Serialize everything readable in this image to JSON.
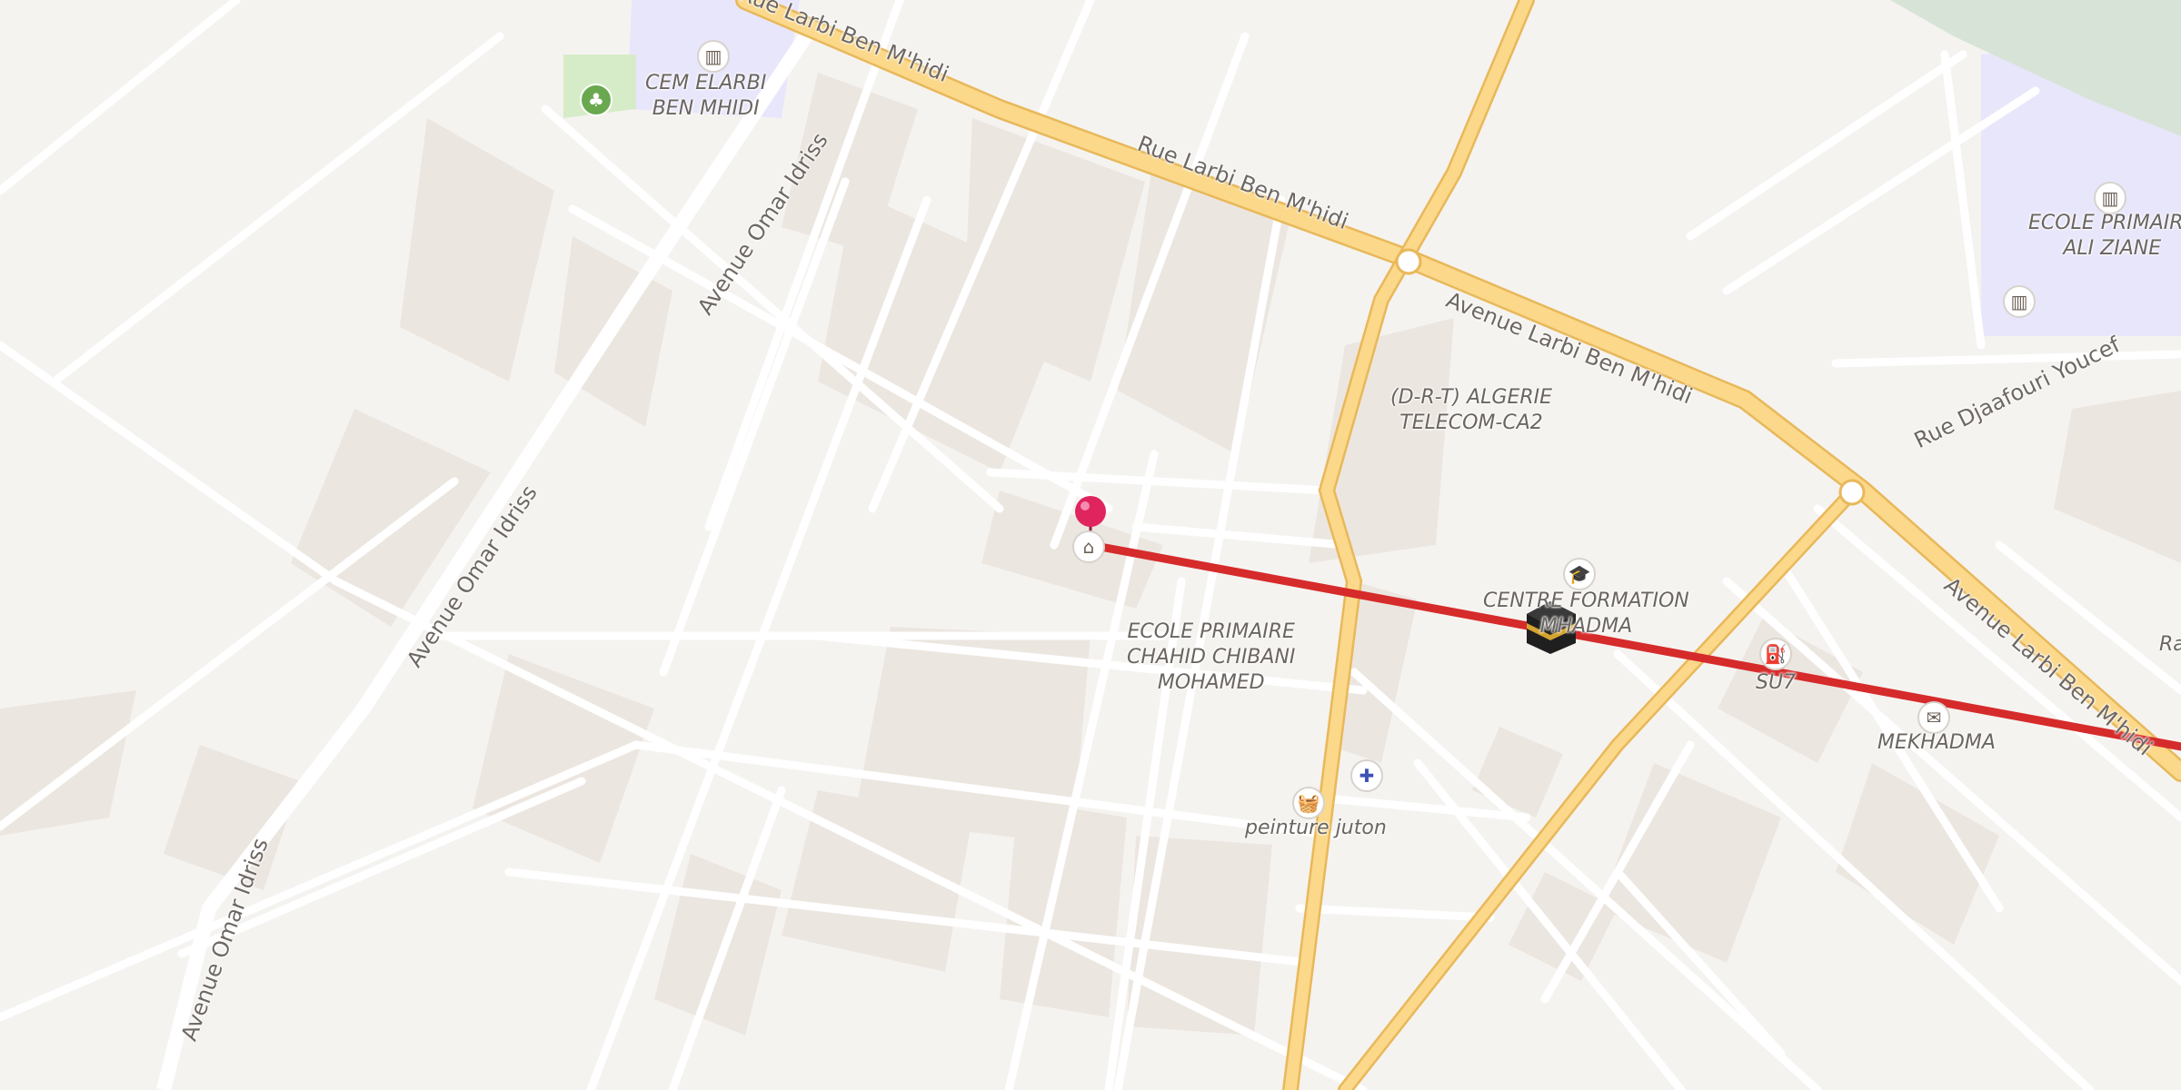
{
  "map": {
    "colors": {
      "background": "#f5f3f0",
      "block": "#ece6e0",
      "street": "#ffffff",
      "main_road": "#fbd88a",
      "main_road_edge": "#e8b85a",
      "school_area": "#e8e6fb",
      "park_area": "#d6ecc8",
      "route_line": "#d62b2b",
      "pin": "#e0245e"
    },
    "roads": [
      {
        "id": "rue-larbi-ben-mhidi-top",
        "label": "Rue Larbi Ben M'hidi"
      },
      {
        "id": "rue-larbi-ben-mhidi-mid",
        "label": "Rue Larbi Ben M'hidi"
      },
      {
        "id": "avenue-larbi-ben-mhidi-mid",
        "label": "Avenue Larbi Ben M'hidi"
      },
      {
        "id": "avenue-larbi-ben-mhidi-right",
        "label": "Avenue Larbi Ben M'hidi"
      },
      {
        "id": "avenue-omar-idriss-top",
        "label": "Avenue Omar Idriss"
      },
      {
        "id": "avenue-omar-idriss-mid",
        "label": "Avenue Omar Idriss"
      },
      {
        "id": "avenue-omar-idriss-bottom",
        "label": "Avenue Omar Idriss"
      },
      {
        "id": "rue-djaafouri-youcef",
        "label": "Rue Djaafouri Youcef"
      }
    ],
    "places": [
      {
        "id": "cem-elarbi",
        "label_line1": "CEM ELARBI",
        "label_line2": "BEN MHIDI",
        "icon": "school-icon"
      },
      {
        "id": "ecole-ali-ziane",
        "label_line1": "ECOLE PRIMAIRE",
        "label_line2": "ALI ZIANE",
        "icon": "school-icon"
      },
      {
        "id": "algerie-telecom",
        "label_line1": "(D-R-T) ALGERIE",
        "label_line2": "TELECOM-CA2",
        "icon": ""
      },
      {
        "id": "centre-formation",
        "label_line1": "CENTRE FORMATION",
        "label_line2": "MHADMA",
        "icon": "graduation-cap-icon"
      },
      {
        "id": "ecole-chibani",
        "label_line1": "ECOLE PRIMAIRE",
        "label_line2": "CHAHID CHIBANI",
        "label_line3": "MOHAMED",
        "icon": ""
      },
      {
        "id": "su7",
        "label": "SU7",
        "icon": "gas-station-icon"
      },
      {
        "id": "mekhadma",
        "label": "MEKHADMA",
        "icon": "post-office-icon"
      },
      {
        "id": "peinture-juton",
        "label": "peinture juton",
        "icon": "shopping-basket-icon"
      },
      {
        "id": "pharmacy",
        "icon": "pharmacy-icon"
      },
      {
        "id": "museum",
        "icon": "museum-icon"
      },
      {
        "id": "park",
        "icon": "tree-icon"
      },
      {
        "id": "right-edge-label",
        "label": "Ra"
      }
    ],
    "markers": {
      "origin_pin": "location-pin-icon",
      "qibla_target": "kaaba-icon"
    }
  }
}
